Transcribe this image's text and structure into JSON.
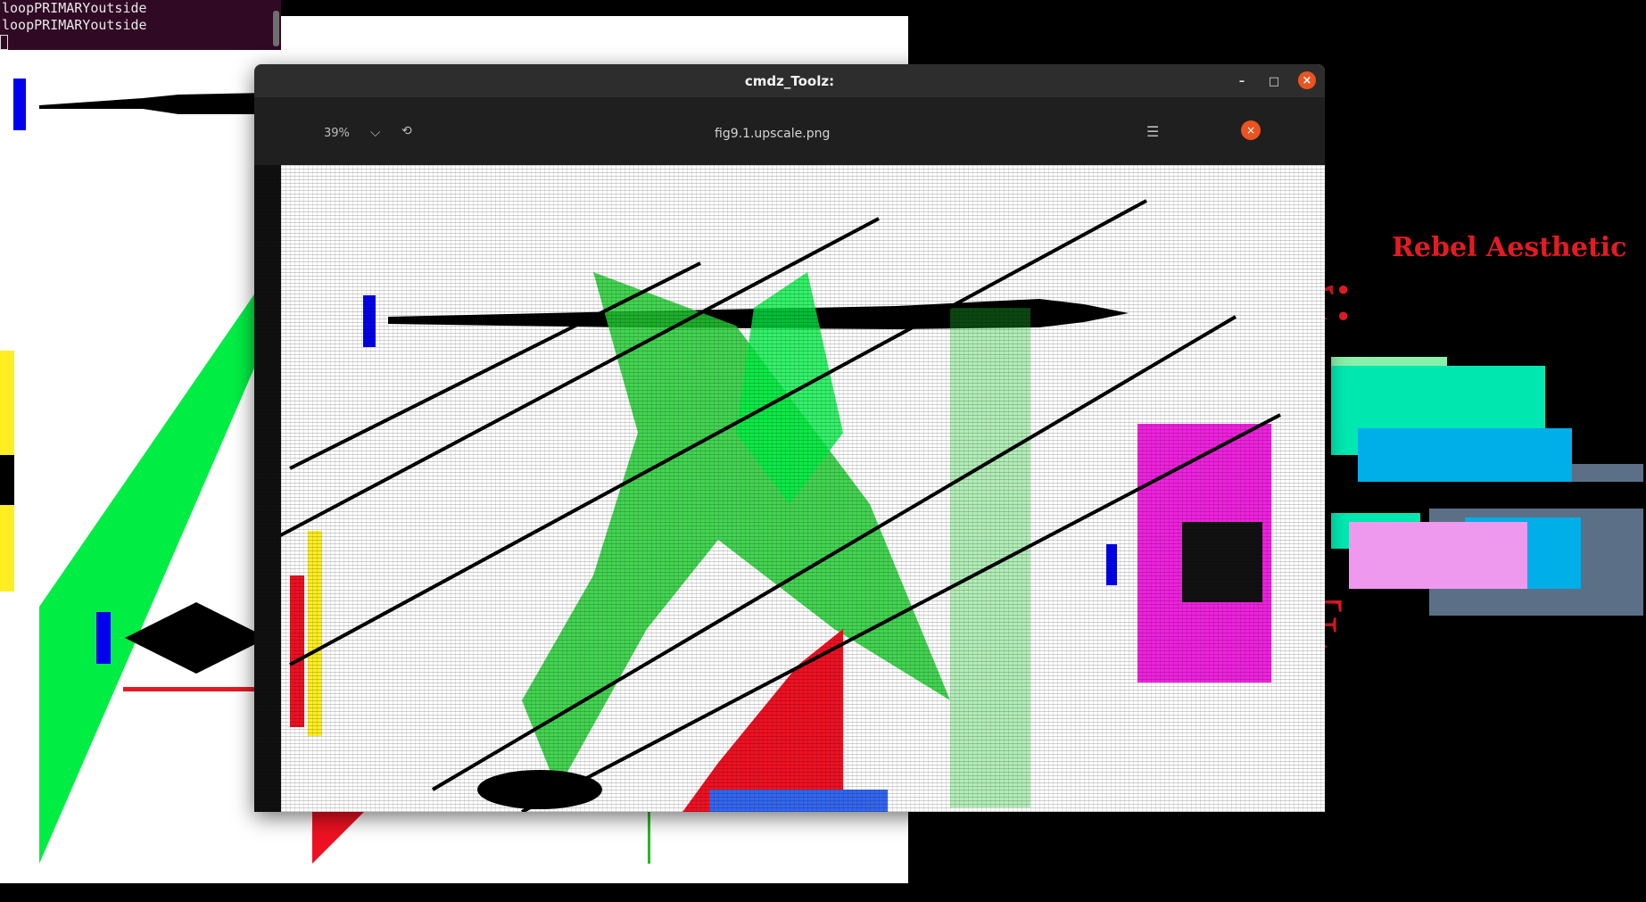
{
  "terminal": {
    "lines": [
      "loopPRIMARYoutside",
      "loopPRIMARYoutside"
    ]
  },
  "window": {
    "title": "cmdz_Toolz:",
    "minimize_icon": "minimize-icon",
    "maximize_icon": "maximize-icon",
    "close_icon": "close-icon",
    "close_glyph": "×",
    "minimize_glyph": "–",
    "maximize_glyph": "□"
  },
  "viewer": {
    "zoom": "39%",
    "filename": "fig9.1.upscale.png",
    "close_glyph": "×",
    "chevron_glyph": "⌵",
    "menu_glyph": "☰",
    "rotate_glyph": "⟲"
  },
  "desktop": {
    "rebel_text": "Rebel Aesthetic",
    "glyph_r": "r:",
    "glyph_f": "F"
  },
  "colors": {
    "accent_close": "#e95420",
    "rebel_red": "#e31b23",
    "terminal_bg": "#300a24"
  }
}
